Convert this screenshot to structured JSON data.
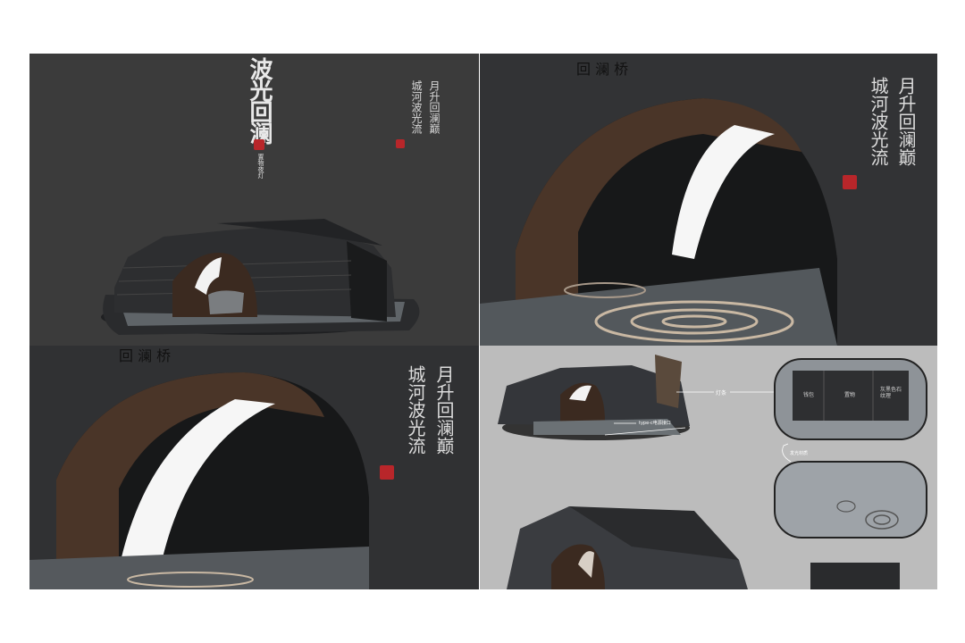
{
  "panel1": {
    "title": "波光回澜",
    "subtitle": "置物夜灯",
    "poem_col1": "月升回澜巅",
    "poem_col2": "城河波光流"
  },
  "panel2": {
    "bridge_inscription": "回 澜 桥",
    "poem_col1": "月升回澜巅",
    "poem_col2": "城河波光流"
  },
  "panel3": {
    "bridge_inscription": "回 澜 桥",
    "poem_col1": "月升回澜巅",
    "poem_col2": "城河波光流"
  },
  "panel4": {
    "label_lightbar": "灯条",
    "label_port": "type-c电源接口",
    "label_glow": "发光材质",
    "tray_labels": [
      "钱包",
      "置物",
      "灰黑色石纹理"
    ]
  },
  "colors": {
    "panel_dark": "#3a3a3a",
    "panel_light_gray": "#bdbdbd",
    "seal_red": "#b8262a",
    "stone_gray": "#2e2f31",
    "wood_brown": "#4a3528",
    "water_gray": "#6f7478"
  }
}
